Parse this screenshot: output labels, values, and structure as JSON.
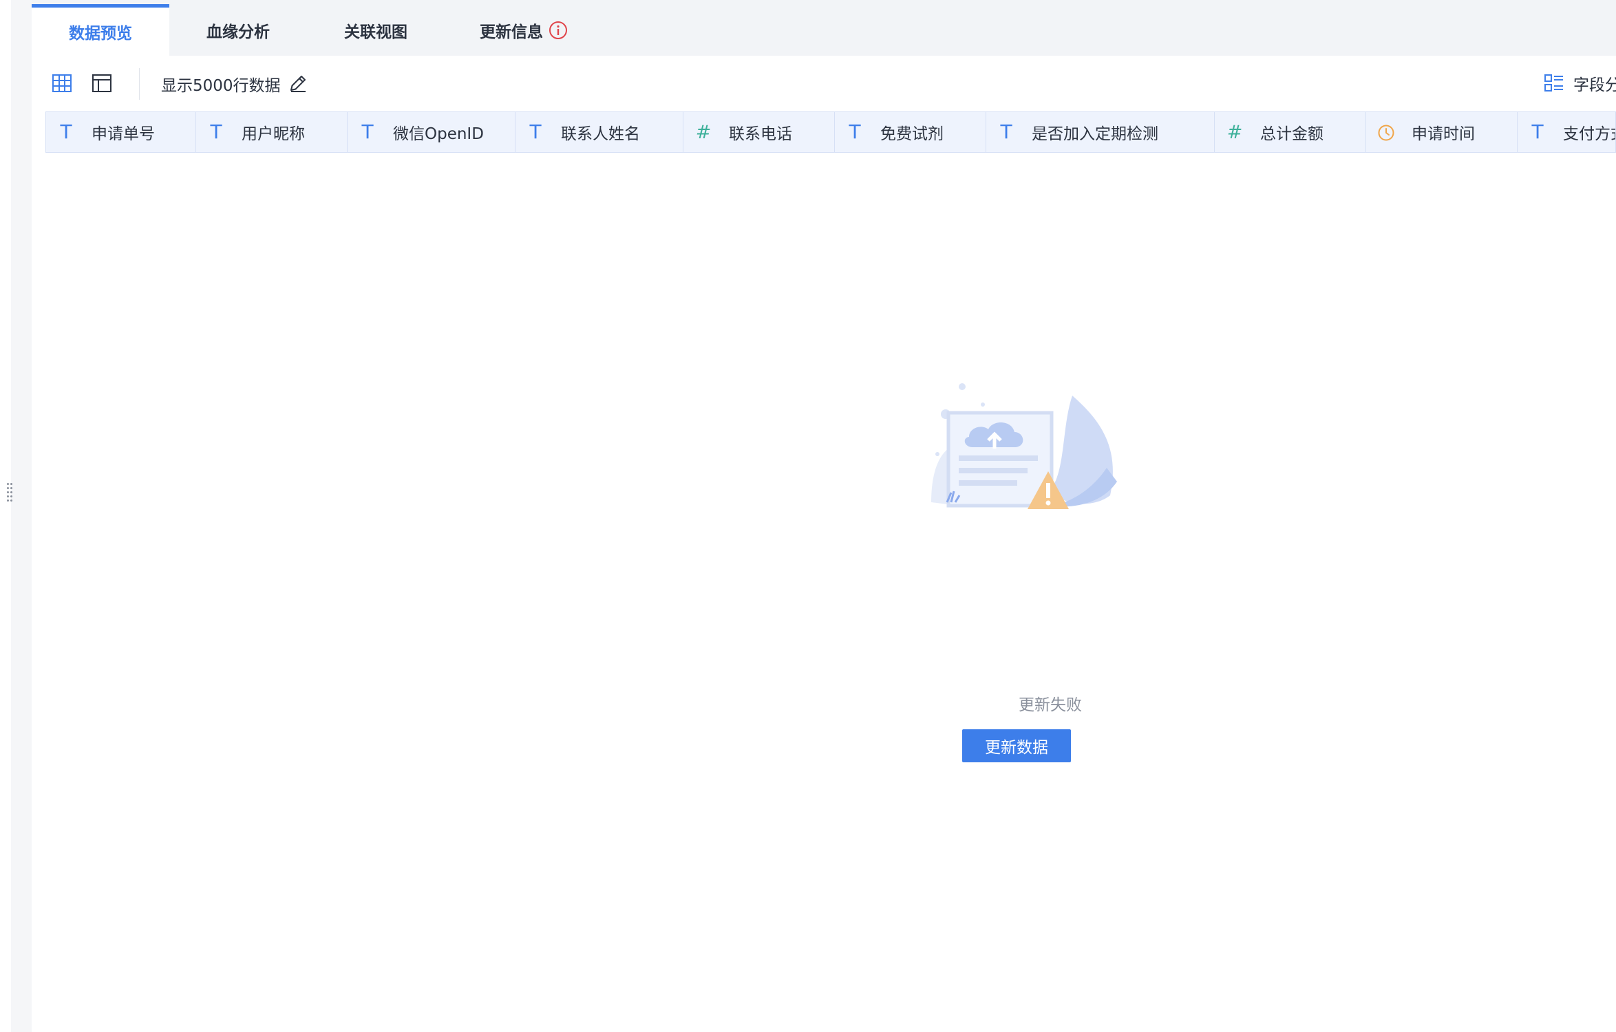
{
  "tabs": [
    {
      "label": "数据预览"
    },
    {
      "label": "血缘分析"
    },
    {
      "label": "关联视图"
    },
    {
      "label": "更新信息"
    }
  ],
  "toolbar": {
    "rows_label": "显示5000行数据",
    "field_button_label": "字段分"
  },
  "columns": [
    {
      "type": "text-icon",
      "label": "申请单号"
    },
    {
      "type": "text-icon",
      "label": "用户昵称"
    },
    {
      "type": "text-icon",
      "label": "微信OpenID"
    },
    {
      "type": "text-icon",
      "label": "联系人姓名"
    },
    {
      "type": "number-icon",
      "label": "联系电话"
    },
    {
      "type": "text-icon",
      "label": "免费试剂"
    },
    {
      "type": "text-icon",
      "label": "是否加入定期检测"
    },
    {
      "type": "number-icon",
      "label": "总计金额"
    },
    {
      "type": "clock-icon",
      "label": "申请时间"
    },
    {
      "type": "text-icon",
      "label": "支付方式"
    }
  ],
  "type_glyphs": {
    "text": "T",
    "number": "#"
  },
  "empty_state": {
    "message": "更新失败",
    "button_label": "更新数据"
  },
  "colors": {
    "accent": "#3d7eea",
    "number_type": "#3db09a",
    "clock": "#f0a64a",
    "error_icon": "#e0454b"
  }
}
